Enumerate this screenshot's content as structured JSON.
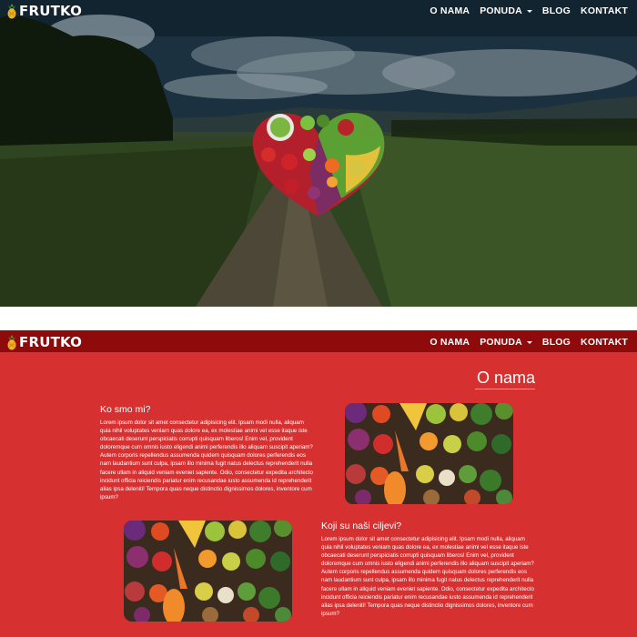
{
  "brand": {
    "name": "FRUTKO"
  },
  "nav": {
    "items": [
      {
        "label": "O NAMA"
      },
      {
        "label": "PONUDA",
        "has_dropdown": true
      },
      {
        "label": "BLOG"
      },
      {
        "label": "KONTAKT"
      }
    ]
  },
  "colors": {
    "section_bg": "#d63030",
    "navbar_bg": "#8f0b0b",
    "text": "#ffffff"
  },
  "about": {
    "title": "O nama",
    "blocks": [
      {
        "heading": "Ko smo mi?",
        "body": "Lorem ipsum dolor sit amet consectetur adipisicing elit. Ipsam modi nulla, aliquam quia nihil voluptates veniam quas dolore ea, ex molestiae animi vel esse itaque iste obcaecati deserunt perspiciatis corrupti quisquam liberos! Enim vel, provident doloremque cum omnis iusto eligendi animi perferendis illo aliquam suscipit aperiam? Autem corporis repellendus assumenda quidem quisquam dolores perferendis eos nam laudantium sunt culpa, ipsam illo minima fugit natus delectus reprehenderit nulla facere ullam in aliquid veniam eveniet sapiente. Odio, consectetur expedita architecto incidunt officia reiciendis pariatur enim recusandae iusto assumenda id reprehenderit alias ipsa deleniti! Tempora quas neque distinctio dignissimos dolores, inventore cum ipsum?"
      },
      {
        "heading": "Koji su naši ciljevi?",
        "body": "Lorem ipsum dolor sit amet consectetur adipisicing elit. Ipsam modi nulla, aliquam quia nihil voluptates veniam quas dolore ea, ex molestiae animi vel esse itaque iste obcaecati deserunt perspiciatis corrupti quisquam liberos! Enim vel, provident doloremque cum omnis iusto eligendi animi perferendis illo aliquam suscipit aperiam? Autem corporis repellendus assumenda quidem quisquam dolores perferendis eos nam laudantium sunt culpa, ipsam illo minima fugit natus delectus reprehenderit nulla facere ullam in aliquid veniam eveniet sapiente. Odio, consectetur expedita architecto incidunt officia reiciendis pariatur enim recusandae iusto assumenda id reprehenderit alias ipsa deleniti! Tempora quas neque distinctio dignissimos dolores, inventore cum ipsum?"
      }
    ]
  }
}
